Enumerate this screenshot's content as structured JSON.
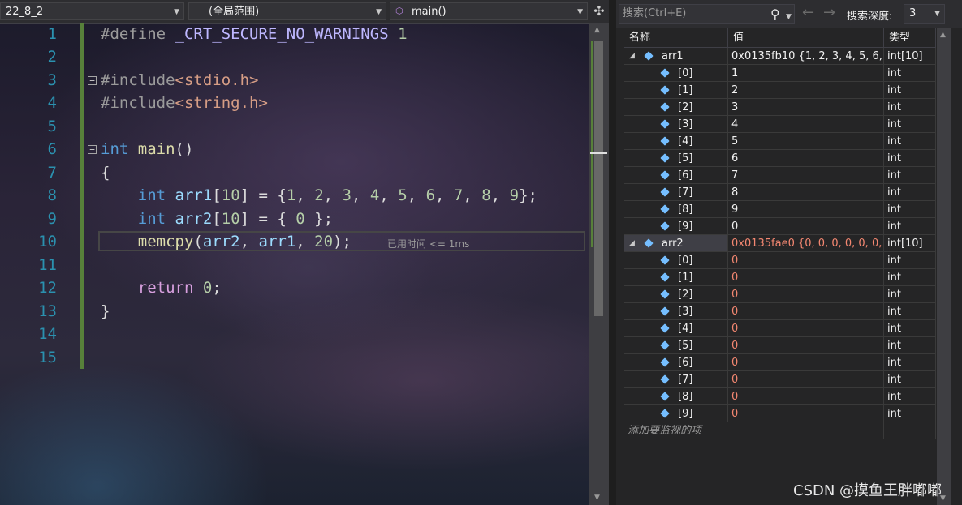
{
  "nav": {
    "project": "22_8_2",
    "scope": "(全局范围)",
    "function": "main()"
  },
  "editor": {
    "line_numbers": [
      "1",
      "2",
      "3",
      "4",
      "5",
      "6",
      "7",
      "8",
      "9",
      "10",
      "11",
      "12",
      "13",
      "14",
      "15"
    ],
    "perf_tip": "已用时间 <= 1ms"
  },
  "watch": {
    "search_placeholder": "搜索(Ctrl+E)",
    "depth_label": "搜索深度:",
    "depth_value": "3",
    "headers": {
      "name": "名称",
      "value": "值",
      "type": "类型"
    },
    "arr1": {
      "name": "arr1",
      "value": "0x0135fb10 {1, 2, 3, 4, 5, 6, ...",
      "type": "int[10]",
      "items": [
        {
          "name": "[0]",
          "value": "1",
          "type": "int"
        },
        {
          "name": "[1]",
          "value": "2",
          "type": "int"
        },
        {
          "name": "[2]",
          "value": "3",
          "type": "int"
        },
        {
          "name": "[3]",
          "value": "4",
          "type": "int"
        },
        {
          "name": "[4]",
          "value": "5",
          "type": "int"
        },
        {
          "name": "[5]",
          "value": "6",
          "type": "int"
        },
        {
          "name": "[6]",
          "value": "7",
          "type": "int"
        },
        {
          "name": "[7]",
          "value": "8",
          "type": "int"
        },
        {
          "name": "[8]",
          "value": "9",
          "type": "int"
        },
        {
          "name": "[9]",
          "value": "0",
          "type": "int"
        }
      ]
    },
    "arr2": {
      "name": "arr2",
      "value": "0x0135fae0 {0, 0, 0, 0, 0, 0, ...",
      "type": "int[10]",
      "items": [
        {
          "name": "[0]",
          "value": "0",
          "type": "int"
        },
        {
          "name": "[1]",
          "value": "0",
          "type": "int"
        },
        {
          "name": "[2]",
          "value": "0",
          "type": "int"
        },
        {
          "name": "[3]",
          "value": "0",
          "type": "int"
        },
        {
          "name": "[4]",
          "value": "0",
          "type": "int"
        },
        {
          "name": "[5]",
          "value": "0",
          "type": "int"
        },
        {
          "name": "[6]",
          "value": "0",
          "type": "int"
        },
        {
          "name": "[7]",
          "value": "0",
          "type": "int"
        },
        {
          "name": "[8]",
          "value": "0",
          "type": "int"
        },
        {
          "name": "[9]",
          "value": "0",
          "type": "int"
        }
      ]
    },
    "add_item": "添加要监视的项"
  },
  "watermark": "CSDN @摸鱼王胖嘟嘟",
  "colors": {
    "changed_value": "#f48771",
    "change_bar": "#57803a",
    "line_number": "#2b91af"
  }
}
